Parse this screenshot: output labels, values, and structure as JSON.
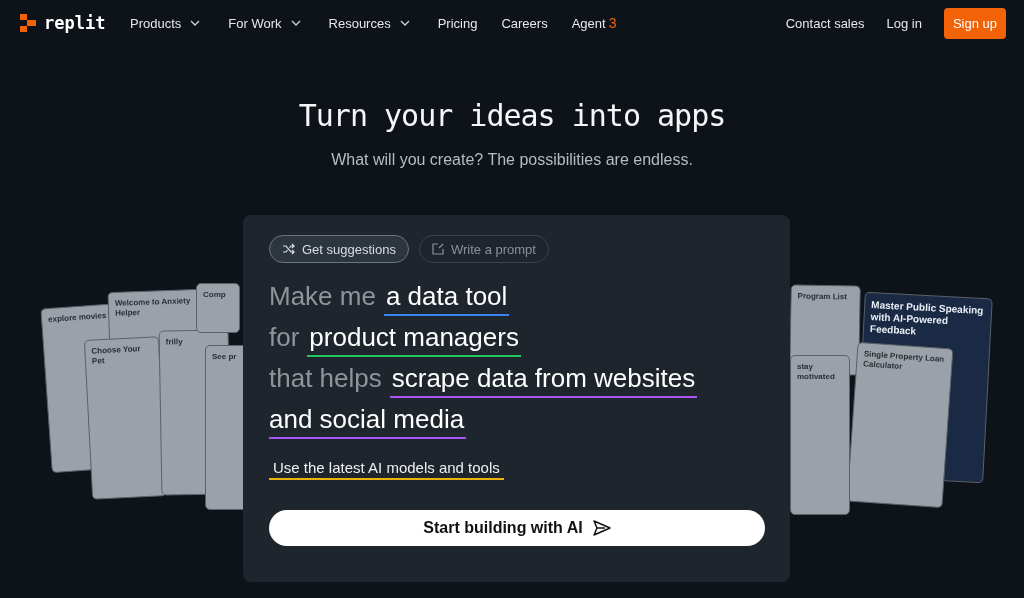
{
  "nav": {
    "logo": "replit",
    "items": [
      {
        "label": "Products",
        "has_dropdown": true
      },
      {
        "label": "For Work",
        "has_dropdown": true
      },
      {
        "label": "Resources",
        "has_dropdown": true
      },
      {
        "label": "Pricing",
        "has_dropdown": false
      },
      {
        "label": "Careers",
        "has_dropdown": false
      },
      {
        "label": "Agent",
        "badge": "3",
        "has_dropdown": false
      }
    ],
    "actions": [
      {
        "label": "Contact sales",
        "kind": "link"
      },
      {
        "label": "Log in",
        "kind": "link"
      },
      {
        "label": "Sign up",
        "kind": "primary"
      }
    ]
  },
  "hero": {
    "title": "Turn your ideas into apps",
    "subtitle": "What will you create? The possibilities are endless."
  },
  "showcase": {
    "left": [
      {
        "title": "explore movies"
      },
      {
        "title": "Welcome to Anxiety Helper"
      },
      {
        "title": "Choose Your Pet"
      },
      {
        "title": "frilly"
      },
      {
        "title": "Comp"
      },
      {
        "title": "See pr"
      }
    ],
    "right": [
      {
        "title": "Program List"
      },
      {
        "title": "Master Public Speaking with AI-Powered Feedback",
        "kind": "dark"
      },
      {
        "title": "Single Property Loan Calculator"
      },
      {
        "title": "stay motivated"
      }
    ]
  },
  "prompt_card": {
    "tabs": [
      {
        "label": "Get suggestions",
        "selected": true
      },
      {
        "label": "Write a prompt",
        "selected": false
      }
    ],
    "lines": [
      {
        "lead": "Make me",
        "choice": "a data tool",
        "color": "#3b82f6"
      },
      {
        "lead": "for",
        "choice": "product managers",
        "color": "#22c55e"
      },
      {
        "lead": "that helps",
        "choice": "scrape data from websites",
        "color": "#a855f7"
      },
      {
        "choice": "and social media",
        "color": "#a855f7"
      }
    ],
    "option": {
      "label": "Use the latest AI models and tools",
      "color": "#eab308"
    },
    "cta": "Start building with AI"
  }
}
